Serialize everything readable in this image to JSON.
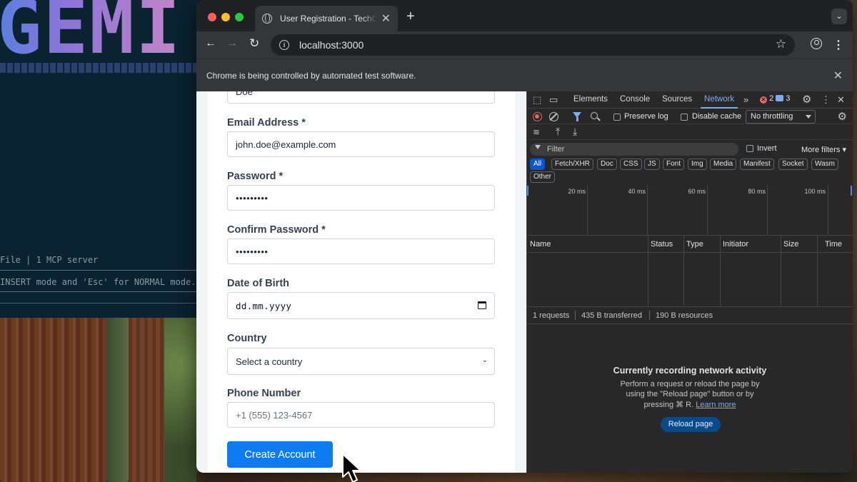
{
  "terminal": {
    "logo_text": "GEMI",
    "line1": "File | 1 MCP server",
    "line2": "INSERT mode and 'Esc' for NORMAL mode."
  },
  "browser": {
    "tab_title": "User Registration - TechCorp",
    "tab_close": "✕",
    "new_tab": "+",
    "url": "localhost:3000",
    "infobar_text": "Chrome is being controlled by automated test software.",
    "infobar_close": "✕"
  },
  "form": {
    "partial_value": "Doe",
    "email": {
      "label": "Email Address *",
      "value": "john.doe@example.com"
    },
    "password": {
      "label": "Password *",
      "value": "•••••••••"
    },
    "confirm_password": {
      "label": "Confirm Password *",
      "value": "•••••••••"
    },
    "dob": {
      "label": "Date of Birth",
      "placeholder": "dd.mm.yyyy"
    },
    "country": {
      "label": "Country",
      "value": "Select a country"
    },
    "phone": {
      "label": "Phone Number",
      "placeholder": "+1 (555) 123-4567"
    },
    "submit_label": "Create Account"
  },
  "devtools": {
    "tabs": [
      "Elements",
      "Console",
      "Sources",
      "Network"
    ],
    "active_tab": "Network",
    "errors_count": "2",
    "messages_count": "3",
    "preserve_log": "Preserve log",
    "disable_cache": "Disable cache",
    "throttling": "No throttling",
    "filter_placeholder": "Filter",
    "invert": "Invert",
    "more_filters": "More filters",
    "chips": [
      "All",
      "Fetch/XHR",
      "Doc",
      "CSS",
      "JS",
      "Font",
      "Img",
      "Media",
      "Manifest",
      "Socket",
      "Wasm",
      "Other"
    ],
    "timeline_labels": [
      "20 ms",
      "40 ms",
      "60 ms",
      "80 ms",
      "100 ms"
    ],
    "columns": [
      "Name",
      "Status",
      "Type",
      "Initiator",
      "Size",
      "Time"
    ],
    "summary": {
      "requests": "1 requests",
      "transferred": "435 B transferred",
      "resources": "190 B resources"
    },
    "empty_title": "Currently recording network activity",
    "empty_line1": "Perform a request or reload the page by",
    "empty_line2": "using the \"Reload page\" button or by",
    "empty_line3": "pressing ⌘ R.",
    "learn_more": "Learn more",
    "reload_button": "Reload page"
  },
  "colors": {
    "accent": "#0d7bf2",
    "devtools_active": "#7cacf8",
    "error": "#e46962"
  }
}
